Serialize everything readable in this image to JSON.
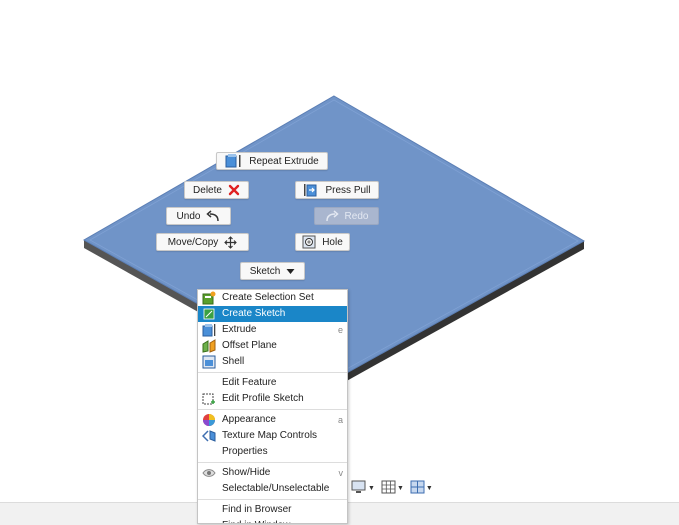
{
  "marking_menu": {
    "repeat_extrude": "Repeat Extrude",
    "delete": "Delete",
    "press_pull": "Press Pull",
    "undo": "Undo",
    "redo": "Redo",
    "move_copy": "Move/Copy",
    "hole": "Hole",
    "sketch": "Sketch"
  },
  "context_menu": {
    "groups": [
      [
        {
          "label": "Create Selection Set",
          "icon": "selection-set-icon",
          "shortcut": ""
        },
        {
          "label": "Create Sketch",
          "icon": "create-sketch-icon",
          "shortcut": "",
          "selected": true
        },
        {
          "label": "Extrude",
          "icon": "extrude-icon",
          "shortcut": "e"
        },
        {
          "label": "Offset Plane",
          "icon": "offset-plane-icon",
          "shortcut": ""
        },
        {
          "label": "Shell",
          "icon": "shell-icon",
          "shortcut": ""
        }
      ],
      [
        {
          "label": "Edit Feature",
          "icon": "",
          "shortcut": ""
        },
        {
          "label": "Edit Profile Sketch",
          "icon": "edit-profile-sketch-icon",
          "shortcut": ""
        }
      ],
      [
        {
          "label": "Appearance",
          "icon": "appearance-icon",
          "shortcut": "a"
        },
        {
          "label": "Texture Map Controls",
          "icon": "texture-map-icon",
          "shortcut": ""
        },
        {
          "label": "Properties",
          "icon": "",
          "shortcut": ""
        }
      ],
      [
        {
          "label": "Show/Hide",
          "icon": "eye-icon",
          "shortcut": "v"
        },
        {
          "label": "Selectable/Unselectable",
          "icon": "",
          "shortcut": ""
        }
      ],
      [
        {
          "label": "Find in Browser",
          "icon": "",
          "shortcut": ""
        },
        {
          "label": "Find in Window",
          "icon": "",
          "shortcut": ""
        }
      ]
    ]
  },
  "view_controls": [
    {
      "icon": "display-settings-icon"
    },
    {
      "icon": "grid-icon"
    },
    {
      "icon": "viewports-icon"
    }
  ],
  "colors": {
    "plate_top": "#7094c8",
    "plate_edge": "#3d3d3d",
    "menu_highlight": "#1a86c8",
    "delete_x": "#e02020"
  }
}
